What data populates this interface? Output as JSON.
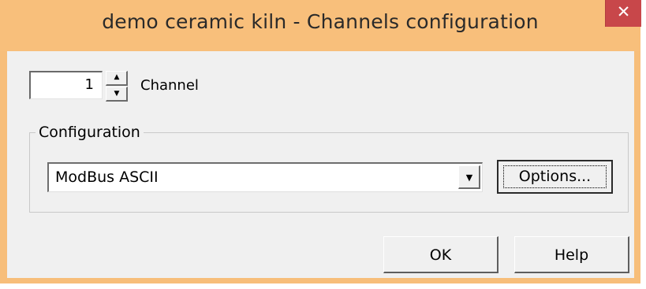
{
  "window": {
    "title": "demo ceramic kiln - Channels configuration",
    "close_glyph": "✕",
    "colors": {
      "titlebar": "#f8bf7b",
      "close_button": "#c8474a",
      "client": "#f0f0f0"
    }
  },
  "channel": {
    "value": "1",
    "label": "Channel",
    "up_icon": "spin-up-arrow",
    "down_icon": "spin-down-arrow"
  },
  "configuration": {
    "group_label": "Configuration",
    "selected_protocol": "ModBus ASCII",
    "dropdown_icon": "chevron-down",
    "options_label": "Options..."
  },
  "dialog_buttons": {
    "ok_label": "OK",
    "help_label": "Help"
  }
}
